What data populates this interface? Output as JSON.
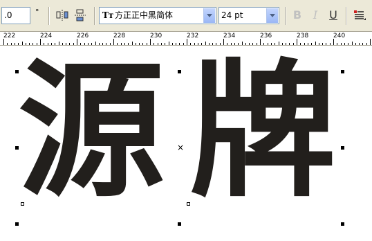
{
  "toolbar": {
    "angle_value": ".0",
    "degree_symbol": "°",
    "font_type_icon": "truetype-font-icon",
    "font_name": "方正正中黑简体",
    "font_size": "24 pt",
    "bold_label": "B",
    "italic_label": "I",
    "underline_label": "U"
  },
  "ruler": {
    "labels": [
      "222",
      "224",
      "226",
      "228",
      "230",
      "232",
      "234",
      "236",
      "238",
      "240"
    ]
  },
  "canvas": {
    "text": "源牌",
    "char1": "源",
    "char2": "牌",
    "text_color": "#221f1c"
  }
}
